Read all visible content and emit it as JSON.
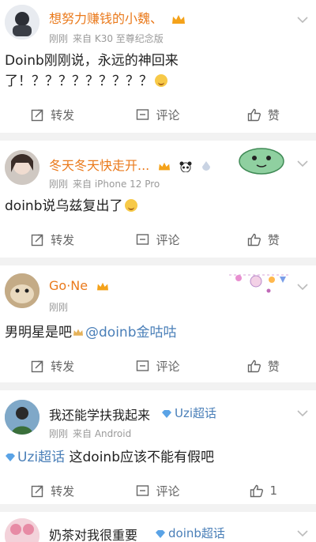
{
  "posts": [
    {
      "username": "想努力赚钱的小魏、",
      "time": "刚刚",
      "source": "来自 K30 至尊纪念版",
      "content": "Doinb刚刚说，永远的神回来了！？？？？？？？？？",
      "repost_label": "转发",
      "comment_label": "评论",
      "like_label": "赞"
    },
    {
      "username": "冬天冬天快走开...",
      "time": "刚刚",
      "source": "来自 iPhone 12 Pro",
      "content": "doinb说乌兹复出了",
      "repost_label": "转发",
      "comment_label": "评论",
      "like_label": "赞"
    },
    {
      "username": "Go·Ne",
      "time": "刚刚",
      "content_prefix": "男明星是吧",
      "mention": "@doinb金咕咕",
      "repost_label": "转发",
      "comment_label": "评论",
      "like_label": "赞"
    },
    {
      "username": "我还能学扶我起来",
      "super_topic": "Uzi超话",
      "time": "刚刚",
      "source": "来自 Android",
      "topic_tag": "Uzi超话",
      "content": "这doinb应该不能有假吧",
      "repost_label": "转发",
      "comment_label": "评论",
      "like_count": "1"
    },
    {
      "username": "奶茶对我很重要",
      "super_topic": "doinb超话"
    }
  ],
  "colors": {
    "orange_name": "#ea7a1c",
    "topic_blue": "#4a7fb8",
    "meta_grey": "#9a9a9a",
    "separator": "#f2f2f2"
  },
  "icons": [
    "avatar",
    "crown-icon",
    "chevron-down-icon",
    "repost-icon",
    "comment-icon",
    "like-icon",
    "super-topic-icon",
    "panda-icon",
    "smile-emoji-icon"
  ]
}
